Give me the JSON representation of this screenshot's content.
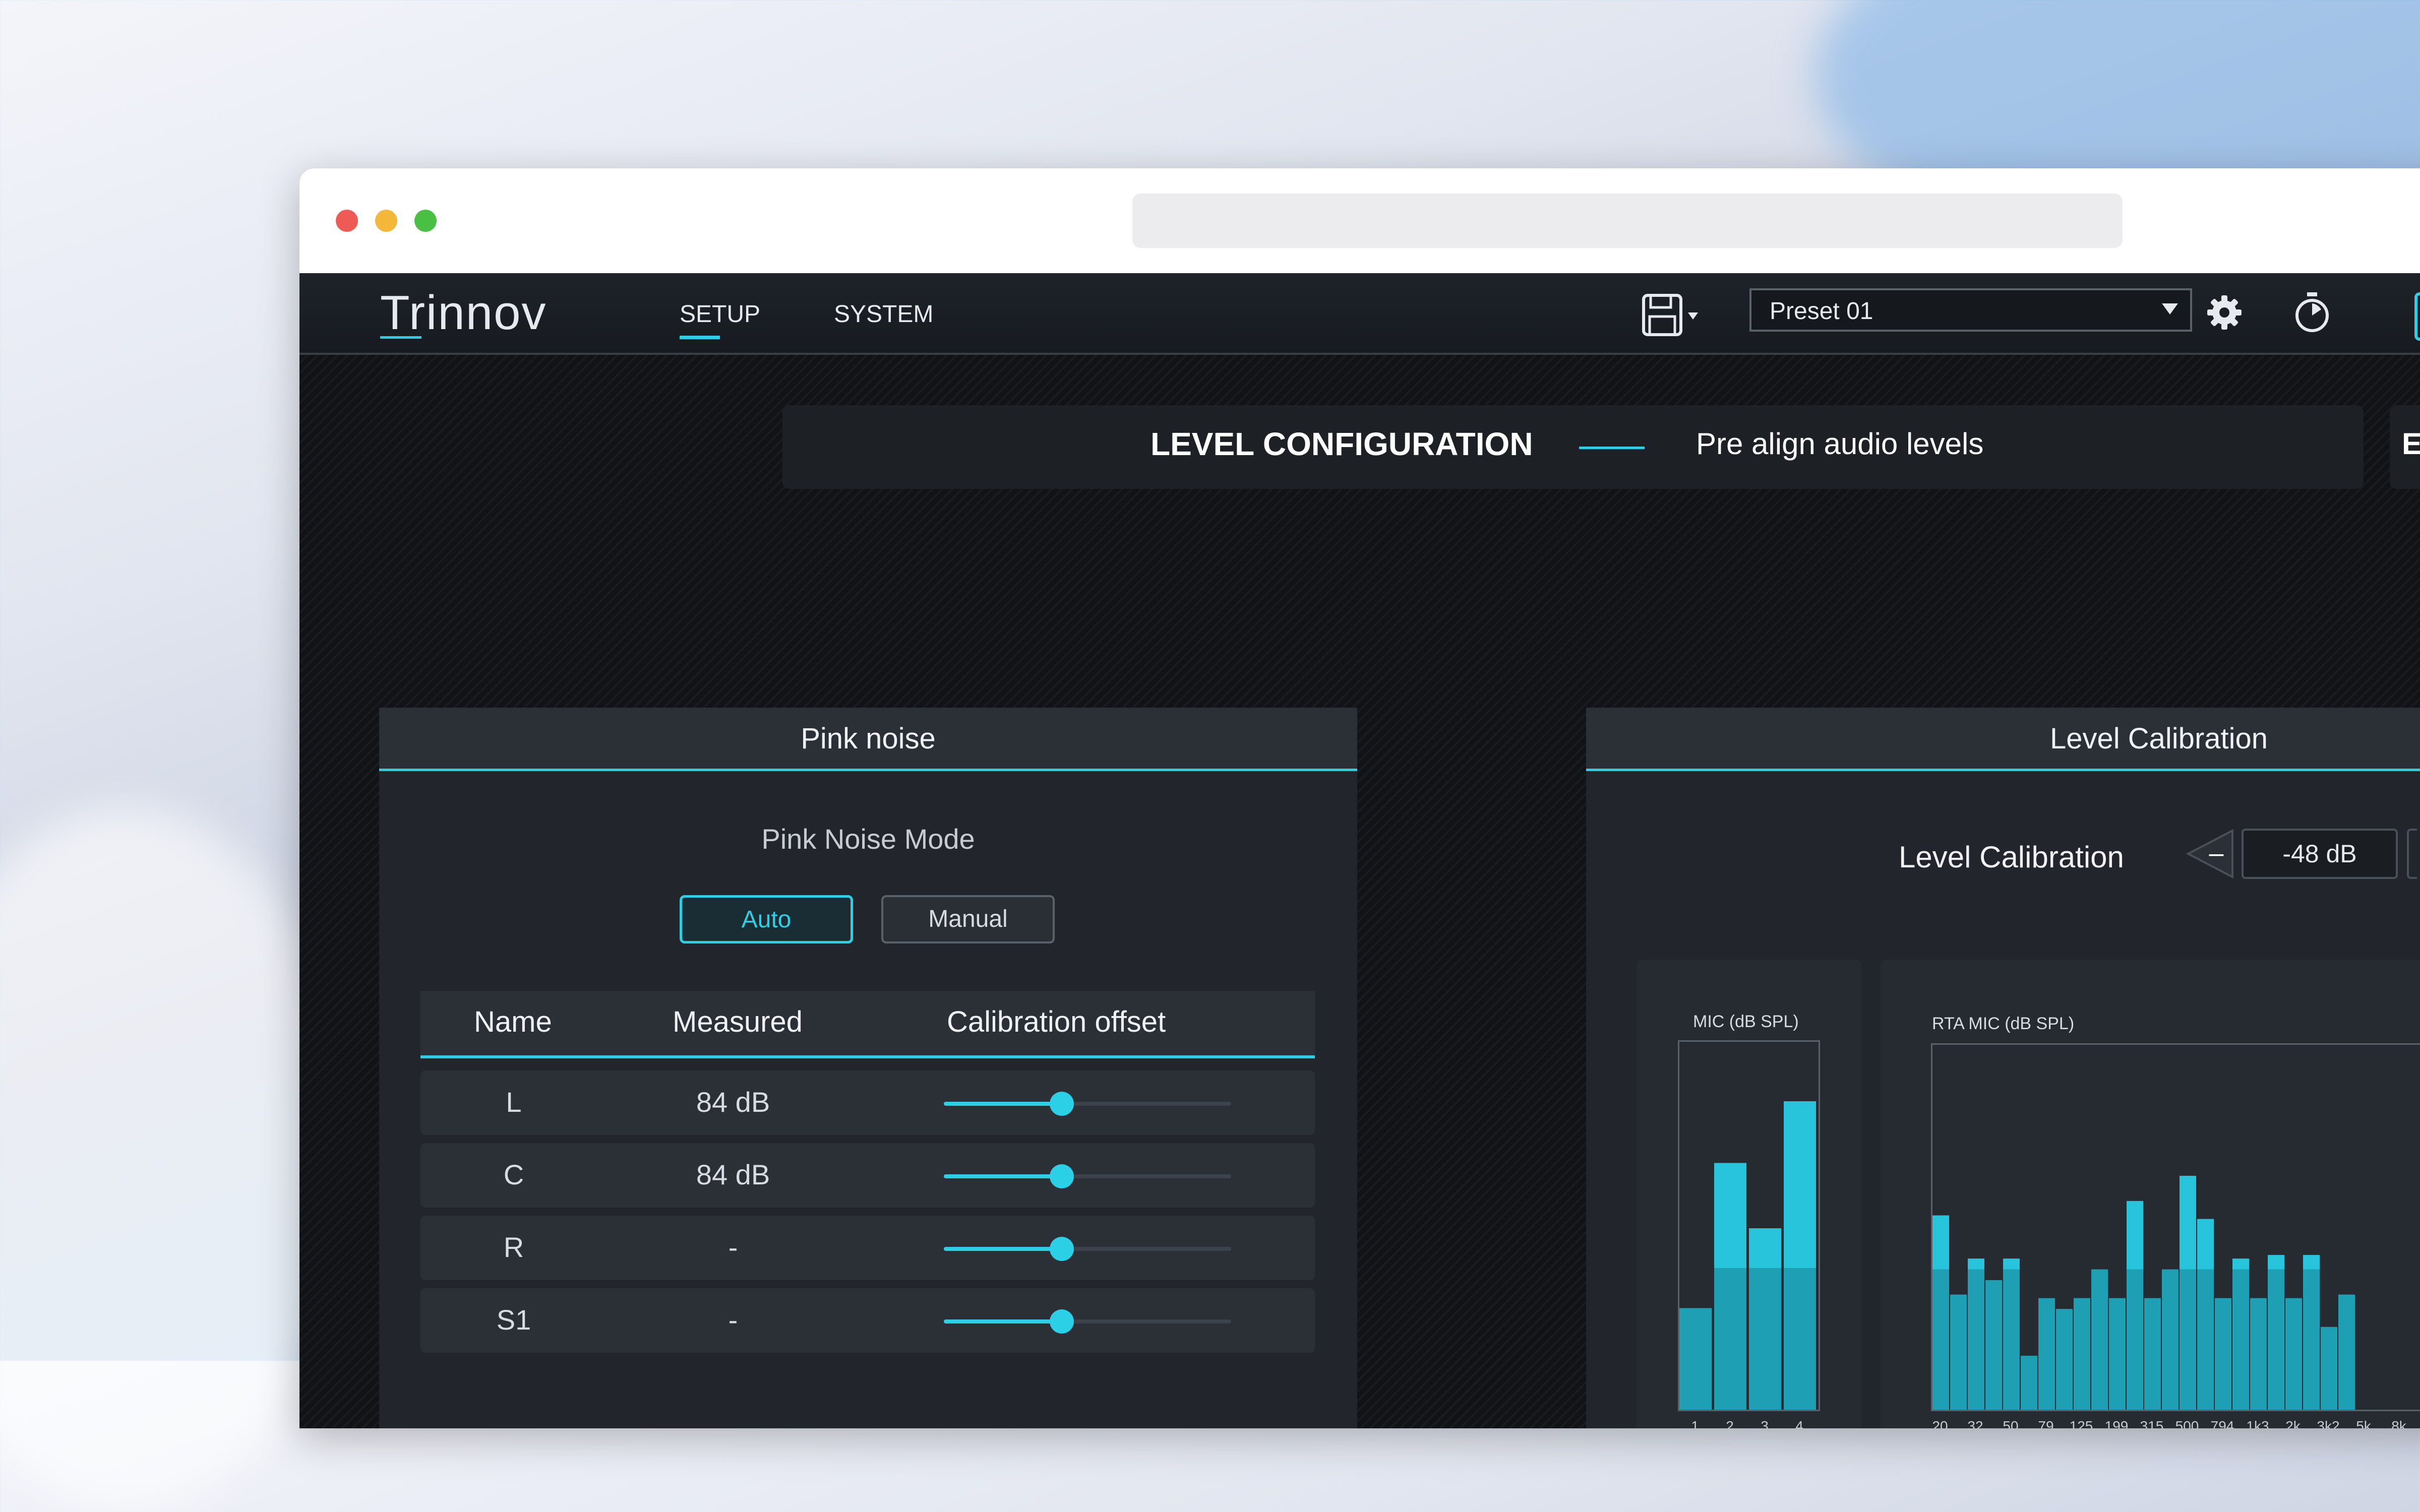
{
  "app": {
    "logo": "Trinnov",
    "nav_tabs": [
      {
        "label": "SETUP",
        "active": true
      },
      {
        "label": "SYSTEM",
        "active": false
      }
    ],
    "preset": "Preset 01",
    "accent_color": "#2bcfe6"
  },
  "header": {
    "title": "LEVEL CONFIGURATION",
    "subtitle": "Pre align audio levels",
    "next_section_initial": "E"
  },
  "pink_noise": {
    "title": "Pink noise",
    "mode_label": "Pink Noise Mode",
    "mode_auto": "Auto",
    "mode_manual": "Manual",
    "selected_mode": "Auto",
    "columns": [
      "Name",
      "Measured",
      "Calibration offset"
    ],
    "rows": [
      {
        "name": "L",
        "measured": "84 dB",
        "offset_fraction": 0.41
      },
      {
        "name": "C",
        "measured": "84 dB",
        "offset_fraction": 0.41
      },
      {
        "name": "R",
        "measured": "-",
        "offset_fraction": 0.41
      },
      {
        "name": "S1",
        "measured": "-",
        "offset_fraction": 0.41
      }
    ]
  },
  "level_calibration": {
    "title": "Level Calibration",
    "label": "Level Calibration",
    "minus": "–",
    "value": "-48 dB"
  },
  "chart_data": [
    {
      "type": "bar",
      "title": "MIC (dB SPL)",
      "categories": [
        "1",
        "2",
        "3",
        "4"
      ],
      "values": [
        0.28,
        0.68,
        0.5,
        0.85
      ],
      "ylim": [
        0,
        1
      ]
    },
    {
      "type": "bar",
      "title": "RTA MIC (dB SPL)",
      "categories": [
        "20",
        "",
        "32",
        "",
        "50",
        "",
        "79",
        "",
        "125",
        "",
        "199",
        "",
        "315",
        "",
        "500",
        "",
        "794",
        "",
        "1k3",
        "",
        "2k",
        "",
        "3k2",
        "",
        "5k",
        "",
        "8k",
        ""
      ],
      "tick_labels": [
        "20",
        "32",
        "50",
        "79",
        "125",
        "199",
        "315",
        "500",
        "794",
        "1k3",
        "2k",
        "3k2",
        "5k",
        "8k"
      ],
      "values": [
        0.54,
        0.32,
        0.42,
        0.36,
        0.42,
        0.15,
        0.31,
        0.28,
        0.31,
        0.39,
        0.31,
        0.58,
        0.31,
        0.39,
        0.65,
        0.53,
        0.31,
        0.42,
        0.31,
        0.43,
        0.31,
        0.43,
        0.23,
        0.32
      ],
      "ylim": [
        0,
        1
      ]
    }
  ]
}
